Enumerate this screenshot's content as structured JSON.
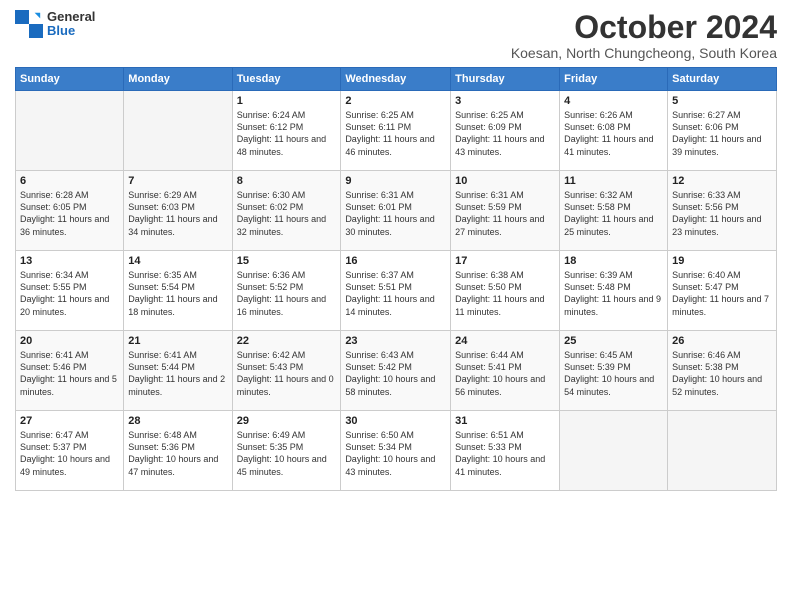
{
  "logo": {
    "general": "General",
    "blue": "Blue"
  },
  "title": "October 2024",
  "location": "Koesan, North Chungcheong, South Korea",
  "days_of_week": [
    "Sunday",
    "Monday",
    "Tuesday",
    "Wednesday",
    "Thursday",
    "Friday",
    "Saturday"
  ],
  "weeks": [
    [
      {
        "day": "",
        "info": ""
      },
      {
        "day": "",
        "info": ""
      },
      {
        "day": "1",
        "info": "Sunrise: 6:24 AM\nSunset: 6:12 PM\nDaylight: 11 hours and 48 minutes."
      },
      {
        "day": "2",
        "info": "Sunrise: 6:25 AM\nSunset: 6:11 PM\nDaylight: 11 hours and 46 minutes."
      },
      {
        "day": "3",
        "info": "Sunrise: 6:25 AM\nSunset: 6:09 PM\nDaylight: 11 hours and 43 minutes."
      },
      {
        "day": "4",
        "info": "Sunrise: 6:26 AM\nSunset: 6:08 PM\nDaylight: 11 hours and 41 minutes."
      },
      {
        "day": "5",
        "info": "Sunrise: 6:27 AM\nSunset: 6:06 PM\nDaylight: 11 hours and 39 minutes."
      }
    ],
    [
      {
        "day": "6",
        "info": "Sunrise: 6:28 AM\nSunset: 6:05 PM\nDaylight: 11 hours and 36 minutes."
      },
      {
        "day": "7",
        "info": "Sunrise: 6:29 AM\nSunset: 6:03 PM\nDaylight: 11 hours and 34 minutes."
      },
      {
        "day": "8",
        "info": "Sunrise: 6:30 AM\nSunset: 6:02 PM\nDaylight: 11 hours and 32 minutes."
      },
      {
        "day": "9",
        "info": "Sunrise: 6:31 AM\nSunset: 6:01 PM\nDaylight: 11 hours and 30 minutes."
      },
      {
        "day": "10",
        "info": "Sunrise: 6:31 AM\nSunset: 5:59 PM\nDaylight: 11 hours and 27 minutes."
      },
      {
        "day": "11",
        "info": "Sunrise: 6:32 AM\nSunset: 5:58 PM\nDaylight: 11 hours and 25 minutes."
      },
      {
        "day": "12",
        "info": "Sunrise: 6:33 AM\nSunset: 5:56 PM\nDaylight: 11 hours and 23 minutes."
      }
    ],
    [
      {
        "day": "13",
        "info": "Sunrise: 6:34 AM\nSunset: 5:55 PM\nDaylight: 11 hours and 20 minutes."
      },
      {
        "day": "14",
        "info": "Sunrise: 6:35 AM\nSunset: 5:54 PM\nDaylight: 11 hours and 18 minutes."
      },
      {
        "day": "15",
        "info": "Sunrise: 6:36 AM\nSunset: 5:52 PM\nDaylight: 11 hours and 16 minutes."
      },
      {
        "day": "16",
        "info": "Sunrise: 6:37 AM\nSunset: 5:51 PM\nDaylight: 11 hours and 14 minutes."
      },
      {
        "day": "17",
        "info": "Sunrise: 6:38 AM\nSunset: 5:50 PM\nDaylight: 11 hours and 11 minutes."
      },
      {
        "day": "18",
        "info": "Sunrise: 6:39 AM\nSunset: 5:48 PM\nDaylight: 11 hours and 9 minutes."
      },
      {
        "day": "19",
        "info": "Sunrise: 6:40 AM\nSunset: 5:47 PM\nDaylight: 11 hours and 7 minutes."
      }
    ],
    [
      {
        "day": "20",
        "info": "Sunrise: 6:41 AM\nSunset: 5:46 PM\nDaylight: 11 hours and 5 minutes."
      },
      {
        "day": "21",
        "info": "Sunrise: 6:41 AM\nSunset: 5:44 PM\nDaylight: 11 hours and 2 minutes."
      },
      {
        "day": "22",
        "info": "Sunrise: 6:42 AM\nSunset: 5:43 PM\nDaylight: 11 hours and 0 minutes."
      },
      {
        "day": "23",
        "info": "Sunrise: 6:43 AM\nSunset: 5:42 PM\nDaylight: 10 hours and 58 minutes."
      },
      {
        "day": "24",
        "info": "Sunrise: 6:44 AM\nSunset: 5:41 PM\nDaylight: 10 hours and 56 minutes."
      },
      {
        "day": "25",
        "info": "Sunrise: 6:45 AM\nSunset: 5:39 PM\nDaylight: 10 hours and 54 minutes."
      },
      {
        "day": "26",
        "info": "Sunrise: 6:46 AM\nSunset: 5:38 PM\nDaylight: 10 hours and 52 minutes."
      }
    ],
    [
      {
        "day": "27",
        "info": "Sunrise: 6:47 AM\nSunset: 5:37 PM\nDaylight: 10 hours and 49 minutes."
      },
      {
        "day": "28",
        "info": "Sunrise: 6:48 AM\nSunset: 5:36 PM\nDaylight: 10 hours and 47 minutes."
      },
      {
        "day": "29",
        "info": "Sunrise: 6:49 AM\nSunset: 5:35 PM\nDaylight: 10 hours and 45 minutes."
      },
      {
        "day": "30",
        "info": "Sunrise: 6:50 AM\nSunset: 5:34 PM\nDaylight: 10 hours and 43 minutes."
      },
      {
        "day": "31",
        "info": "Sunrise: 6:51 AM\nSunset: 5:33 PM\nDaylight: 10 hours and 41 minutes."
      },
      {
        "day": "",
        "info": ""
      },
      {
        "day": "",
        "info": ""
      }
    ]
  ]
}
